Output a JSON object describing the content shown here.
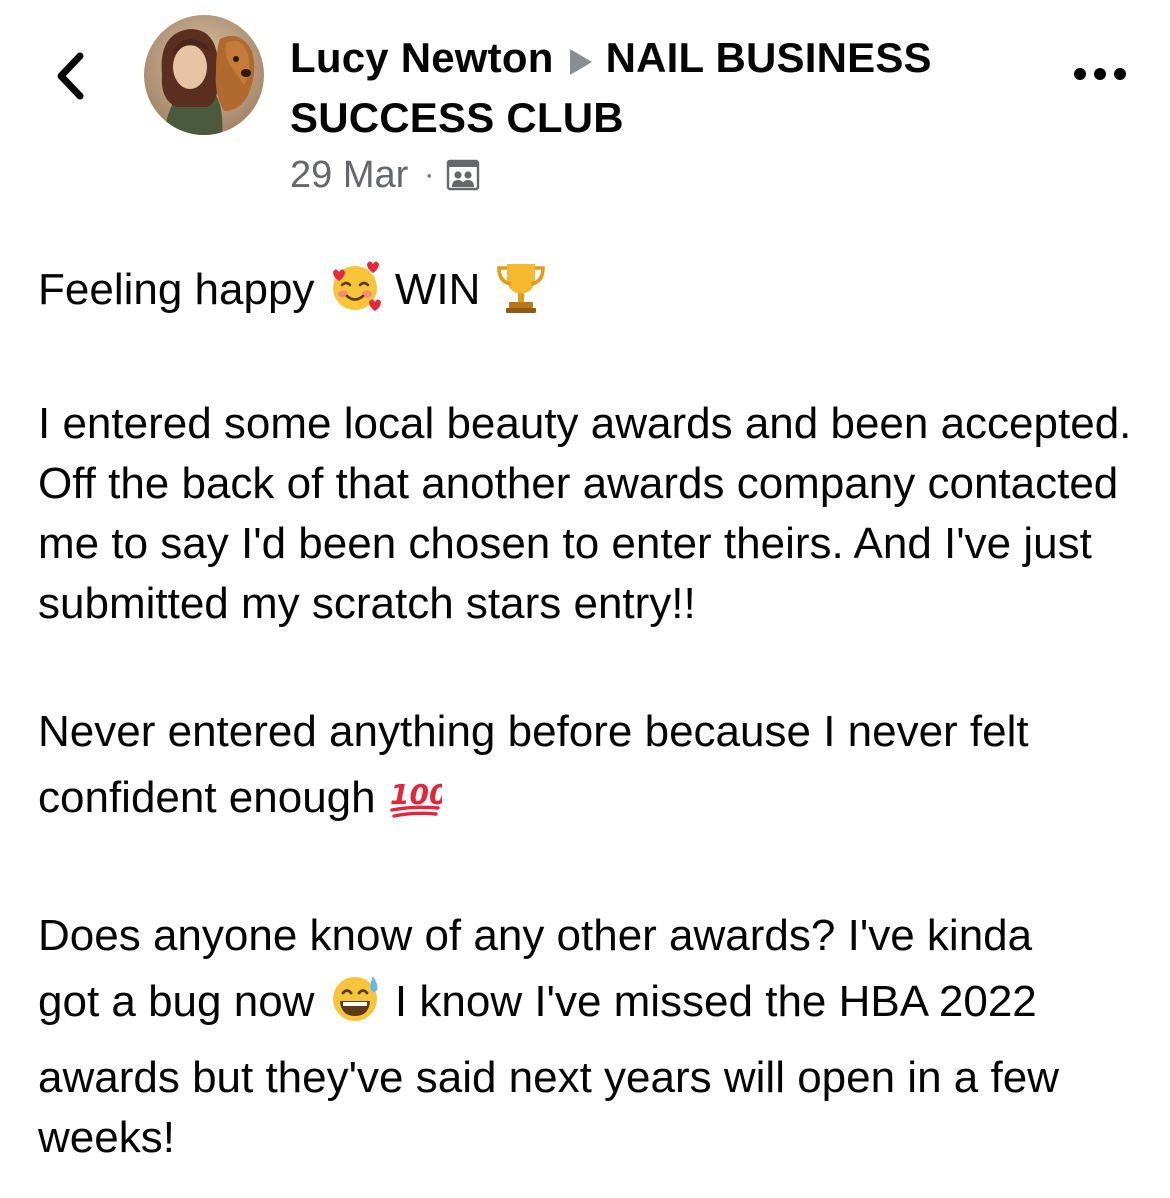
{
  "header": {
    "back_label": "Back",
    "author": "Lucy Newton",
    "group": "NAIL BUSINESS SUCCESS CLUB",
    "date": "29 Mar",
    "separator": "·",
    "audience_icon": "group-members-icon",
    "more_icon": "more-options-icon"
  },
  "post": {
    "p1_text": "Feeling happy",
    "p1_win": "WIN",
    "p1_emojis": [
      "smiling-face-with-hearts-icon",
      "trophy-icon"
    ],
    "p2_text": "I entered some local beauty awards and been accepted. Off the back of that another awards company contacted me to say I'd been chosen to enter theirs. And I've just submitted my scratch stars entry!!",
    "p3_line1": "Never entered anything before because I never felt",
    "p3_line2": "confident enough",
    "p3_emoji": "hundred-points-icon",
    "p4_line1": "Does anyone know of any other awards? I've kinda",
    "p4_line2a": "got a bug now",
    "p4_emoji": "grinning-sweat-icon",
    "p4_line2b": "I know I've missed the HBA 2022",
    "p4_rest": "awards but they've said next years will open in a few weeks!"
  },
  "colors": {
    "text": "#050505",
    "secondary": "#65676b",
    "separator_arrow": "#8a8d91"
  }
}
